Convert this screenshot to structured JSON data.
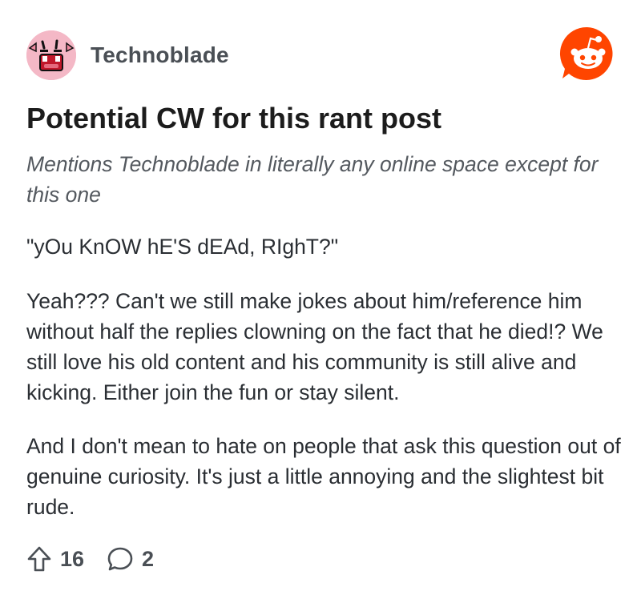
{
  "post": {
    "author": "Technoblade",
    "title": "Potential CW for this rant post",
    "subtitle": "Mentions Technoblade in literally any online space except for this one",
    "paragraphs": [
      "\"yOu KnOW hE'S dEAd, RIghT?\"",
      "Yeah??? Can't we still make jokes about him/reference him without half the replies clowning on the fact that he died!? We still love his old content and his community is still alive and kicking. Either join the fun or stay silent.",
      "And I don't mean to hate on people that ask this question out of genuine curiosity. It's just a little annoying and the slightest bit rude."
    ],
    "upvotes": "16",
    "comments": "2"
  },
  "icons": {
    "avatar": "pig-face-avatar",
    "brand": "reddit-logo-icon",
    "upvote": "upvote-arrow-icon",
    "comment": "comment-bubble-icon"
  },
  "colors": {
    "brand": "#ff4500",
    "avatar_bg": "#f4b8c6",
    "title": "#1c1c1c",
    "meta": "#4a4f55"
  }
}
